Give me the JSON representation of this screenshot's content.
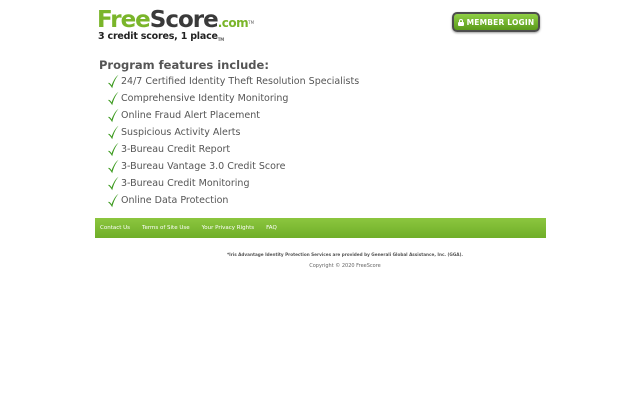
{
  "header": {
    "logo": {
      "part1": "Free",
      "part2": "Score",
      "suffix": ".com",
      "tm": "TM",
      "tagline": "3 credit scores, 1 place",
      "tagline_tm": "TM"
    },
    "login_button": {
      "label": "MEMBER LOGIN",
      "icon": "lock-icon"
    }
  },
  "features": {
    "title": "Program features include:",
    "check_icon": "check-icon",
    "check_color": "#3c9a1e",
    "items": [
      "24/7 Certified Identity Theft Resolution Specialists",
      "Comprehensive Identity Monitoring",
      "Online Fraud Alert Placement",
      "Suspicious Activity Alerts",
      "3-Bureau Credit Report",
      "3-Bureau Vantage 3.0 Credit Score",
      "3-Bureau Credit Monitoring",
      "Online Data Protection"
    ]
  },
  "footer": {
    "bar_color": "#7ab52a",
    "links": [
      "Contact Us",
      "Terms of Site Use",
      "Your Privacy Rights",
      "FAQ"
    ],
    "disclaimer": "*Iris Advantage Identity Protection Services are provided by Generali Global Assistance, Inc. (GGA).",
    "copyright": "Copyright © 2020 FreeScore"
  }
}
